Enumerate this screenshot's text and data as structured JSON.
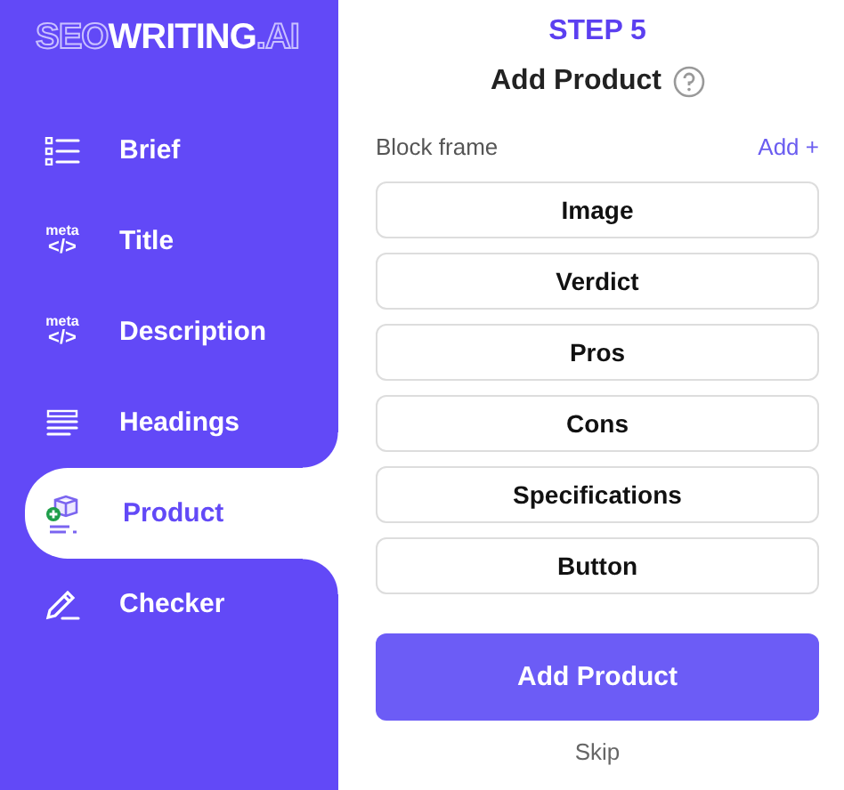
{
  "logo": {
    "outline": "SEO",
    "solid": "WRITING",
    "suffix": ".AI"
  },
  "sidebar": {
    "items": [
      {
        "label": "Brief",
        "icon": {
          "kind": "list"
        },
        "selected": false
      },
      {
        "label": "Title",
        "icon": {
          "kind": "meta",
          "top": "meta",
          "bottom": "</>"
        },
        "selected": false
      },
      {
        "label": "Description",
        "icon": {
          "kind": "meta",
          "top": "meta",
          "bottom": "</>"
        },
        "selected": false
      },
      {
        "label": "Headings",
        "icon": {
          "kind": "lines"
        },
        "selected": false
      },
      {
        "label": "Product",
        "icon": {
          "kind": "box"
        },
        "selected": true
      },
      {
        "label": "Checker",
        "icon": {
          "kind": "pencil"
        },
        "selected": false
      }
    ]
  },
  "step": "STEP 5",
  "title": "Add Product",
  "blocks": {
    "label": "Block frame",
    "add": "Add +",
    "items": [
      "Image",
      "Verdict",
      "Pros",
      "Cons",
      "Specifications",
      "Button"
    ]
  },
  "primary_button": "Add Product",
  "skip": "Skip"
}
